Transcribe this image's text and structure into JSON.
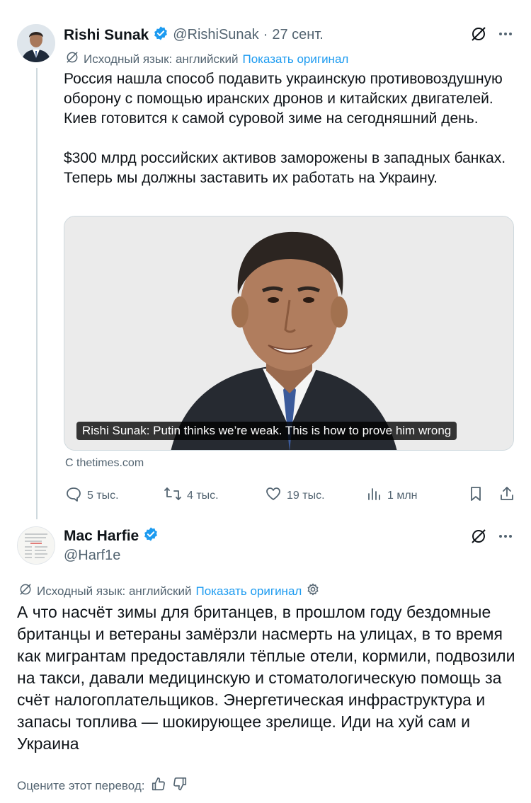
{
  "tweet1": {
    "name": "Rishi Sunak",
    "handle": "@RishiSunak",
    "separator": "·",
    "date": "27 сент.",
    "translation_note": "Исходный язык: английский",
    "show_original": "Показать оригинал",
    "text": "Россия нашла способ подавить украинскую противовоздушную оборону с помощью иранских дронов и китайских двигателей. Киев готовится к самой суровой зиме на сегодняшний день.\n\n$300 млрд российских активов заморожены в западных банках. Теперь мы должны заставить их работать на Украину.",
    "card_title": "Rishi Sunak: Putin thinks we’re weak. This is how to prove him wrong",
    "card_source": "С thetimes.com",
    "replies": "5 тыс.",
    "reposts": "4 тыс.",
    "likes": "19 тыс.",
    "views": "1 млн"
  },
  "tweet2": {
    "name": "Mac Harfie",
    "handle": "@Harf1e",
    "translation_note": "Исходный язык: английский",
    "show_original": "Показать оригинал",
    "text": "А что насчёт зимы для британцев, в прошлом году бездомные британцы и ветераны замёрзли насмерть на улицах, в то время как мигрантам предоставляли тёплые отели, кормили, подвозили на такси, давали медицинскую и стоматологическую помощь за счёт налогоплательщиков. Энергетическая инфраструктура и запасы топлива — шокирующее зрелище. Иди на хуй сам и Украина",
    "rate_translation": "Оцените этот перевод:"
  },
  "colors": {
    "verified": "#1d9bf0",
    "link": "#1d9bf0",
    "muted": "#536471",
    "text": "#0f1419"
  }
}
